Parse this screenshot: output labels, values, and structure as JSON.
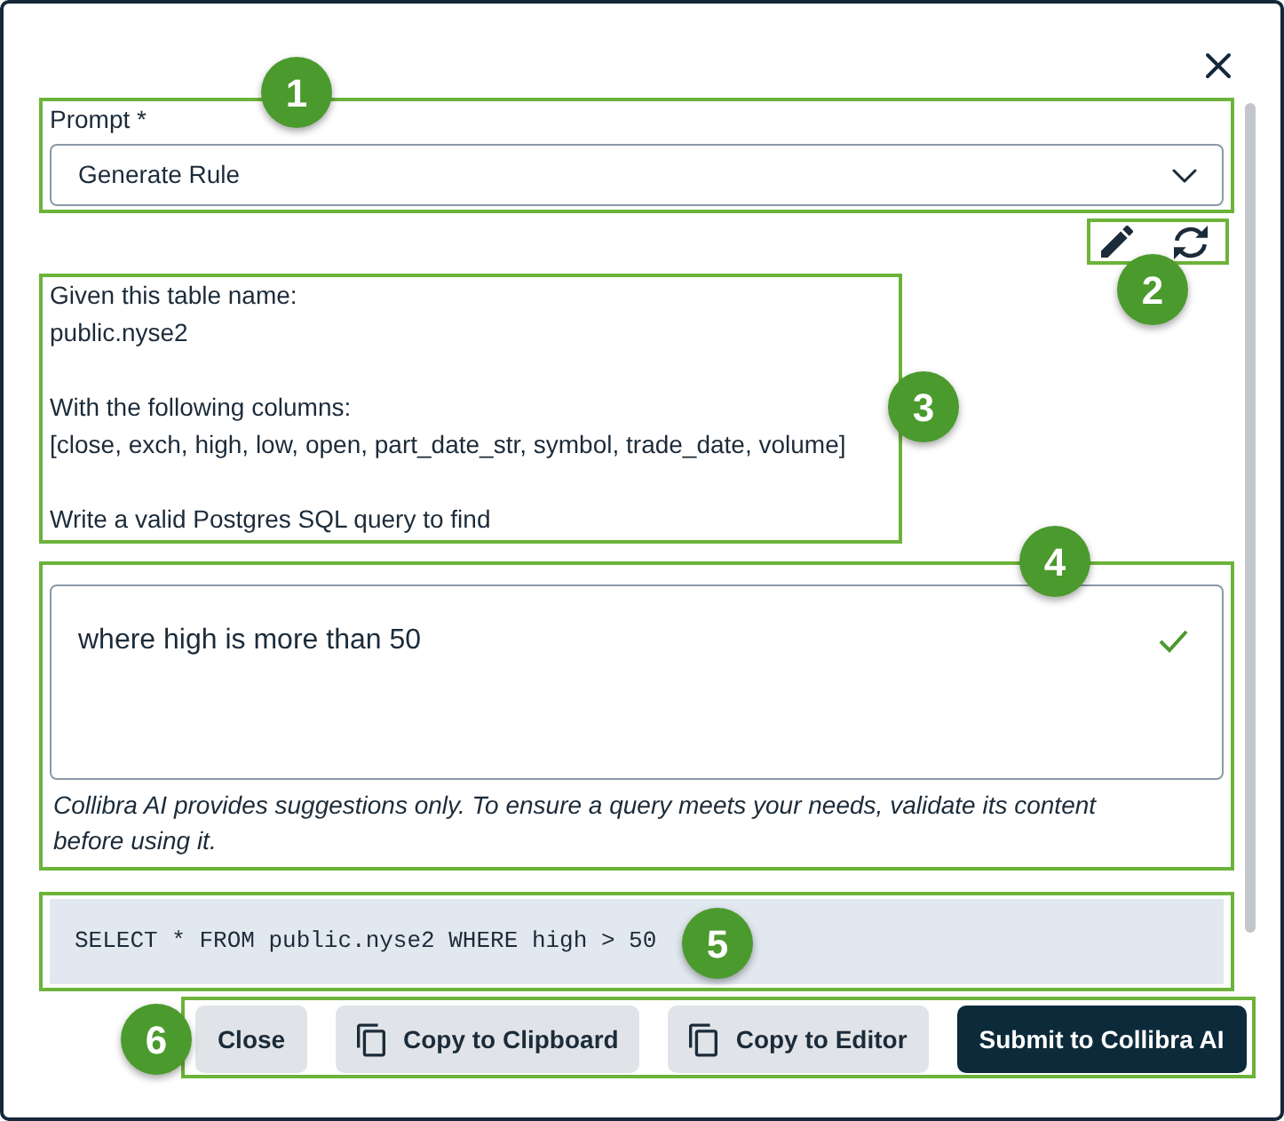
{
  "prompt_field": {
    "label": "Prompt *",
    "value": "Generate Rule",
    "callout": "1"
  },
  "prompt_tools": {
    "callout": "2"
  },
  "template_text": {
    "paragraphs": [
      "Given this table name:\npublic.nyse2",
      "With the following columns:\n[close, exch, high, low, open, part_date_str, symbol, trade_date, volume]",
      "Write a valid Postgres SQL query to find"
    ],
    "callout": "3"
  },
  "query_input": {
    "value": "where high is more than 50",
    "valid": true,
    "disclaimer": "Collibra AI provides suggestions only. To ensure a query meets your needs, validate its content before using it.",
    "callout": "4"
  },
  "generated_sql": {
    "code": "SELECT * FROM public.nyse2 WHERE high > 50",
    "callout": "5"
  },
  "actions": {
    "buttons": [
      {
        "label": "Close",
        "kind": "plain"
      },
      {
        "label": "Copy to Clipboard",
        "kind": "copy"
      },
      {
        "label": "Copy to Editor",
        "kind": "copy"
      },
      {
        "label": "Submit to Collibra AI",
        "kind": "primary"
      }
    ],
    "callout": "6"
  }
}
